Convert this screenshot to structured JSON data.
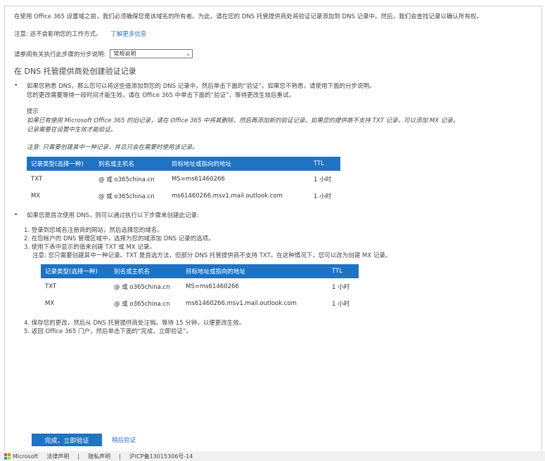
{
  "intro": {
    "text": "在使用 Office 365 设置域之前，我们必须确保您是该域名的所有者。为此，请在您的 DNS 托管提供商处将验证记录添加到 DNS 记录中。然后，我们会查找记录以确认所有权。",
    "note_prefix": "注意: 这不会影响您的工作方式。",
    "learn_more": "了解更多信息"
  },
  "provider_row": {
    "label": "请参阅有关执行此步骤的分步说明:",
    "select_value": "常规说明"
  },
  "section_title": "在 DNS 托管提供商处创建验证记录",
  "bullet1": {
    "lines": [
      "如果您熟悉 DNS，那么您可以将这些值添加到您的 DNS 记录中，然后单击下面的“验证”。如果您不熟悉，请使用下面的分步说明。",
      "您的更改需要等待一段时间才能生效，请在 Office 365 中单击下面的“验证”，等待更改生效后重试。"
    ],
    "tip_label": "提示",
    "tip_lines": [
      "如果已有使用 Microsoft Office 365 的旧记录，请在 Office 365 中将其删除，然后再添加新的验证记录。如果您的提供商不支持 TXT 记录，可以添加 MX 记录。",
      "记录需要在设置中生效才能验证。"
    ],
    "note": "注意: 只需要创建其中一种记录，并且只会在需要时使用该记录。"
  },
  "table1": {
    "headers": [
      "记录类型(选择一种)",
      "别名或主机名",
      "目标地址或指向的地址",
      "TTL"
    ],
    "rows": [
      [
        "TXT",
        "@ 或 o365china.cn",
        "MS=ms61460266",
        "1 小时"
      ],
      [
        "MX",
        "@ 或 o365china.cn",
        "ms61460266.msv1.mail.outlook.com",
        "1 小时"
      ]
    ]
  },
  "bullet2": {
    "text": "如果您是首次使用 DNS，则可以通过执行以下步骤来创建此记录:"
  },
  "steps": {
    "items": [
      "1. 登录到您域名注册商的网站，然后选择您的域名。",
      "2. 在您帐户的 DNS 管理区域中，选择为您的域添加 DNS 记录的选项。",
      "3. 使用下表中显示的值来创建 TXT 或 MX 记录。"
    ],
    "note": "注意: 您只需要创建其中一种记录。TXT 是首选方法，但部分 DNS 托管提供商不支持 TXT。在这种情况下，您可以改为创建 MX 记录。"
  },
  "table2": {
    "headers": [
      "记录类型(选择一种)",
      "别名或主机名",
      "目标地址或指向的地址",
      "TTL"
    ],
    "rows": [
      [
        "TXT",
        "@ 或 o365china.cn",
        "MS=ms61460266",
        "1 小时"
      ],
      [
        "MX",
        "@ 或 o365china.cn",
        "ms61460266.msv1.mail.outlook.com",
        "1 小时"
      ]
    ]
  },
  "steps_after": {
    "items": [
      "4. 保存您的更改，然后从 DNS 托管提供商处注销。等待 15 分钟，以便更改生效。",
      "5. 返回 Office 365 门户，然后单击下面的“完成，立即验证”。"
    ]
  },
  "actions": {
    "verify_button": "完成，立即验证",
    "later_link": "稍后验证"
  },
  "footer": {
    "brand": "Microsoft",
    "links": [
      "法律声明",
      "隐私声明",
      "沪ICP备13015306号-14"
    ],
    "separator": "|"
  },
  "colors": {
    "accent": "#1f73c3",
    "link": "#2a6fd1"
  }
}
